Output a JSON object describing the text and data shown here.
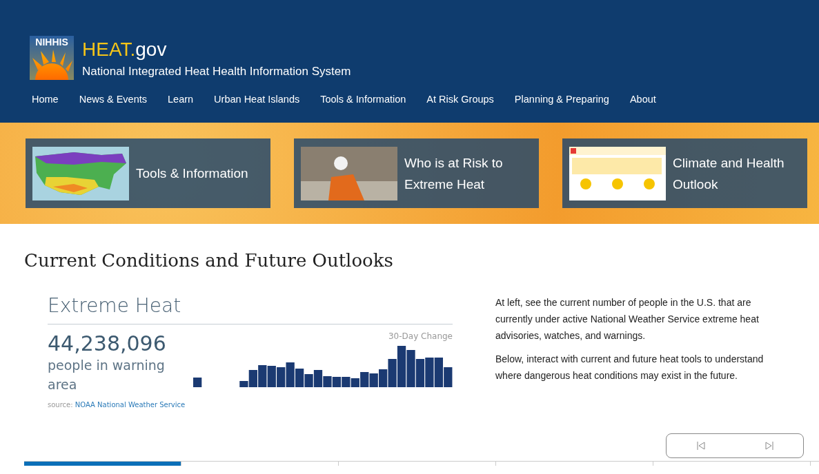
{
  "header": {
    "logo_text": "NIHHIS",
    "site_name_accent": "HEAT.",
    "site_name": "gov",
    "tagline": "National Integrated Heat Health Information System"
  },
  "nav": [
    {
      "label": "Home"
    },
    {
      "label": "News & Events"
    },
    {
      "label": "Learn"
    },
    {
      "label": "Urban Heat Islands"
    },
    {
      "label": "Tools & Information"
    },
    {
      "label": "At Risk Groups"
    },
    {
      "label": "Planning & Preparing"
    },
    {
      "label": "About"
    }
  ],
  "feature_cards": [
    {
      "kind": "map",
      "title": "Tools & Information"
    },
    {
      "kind": "photo",
      "title": "Who is at Risk to Extreme Heat"
    },
    {
      "kind": "poster",
      "title": "Climate and Health Outlook"
    }
  ],
  "section_title": "Current Conditions and Future Outlooks",
  "widget": {
    "title": "Extreme Heat",
    "count": "44,238,096",
    "count_label": "people in warning area",
    "chart_label": "30-Day Change",
    "source_label": "source:",
    "source_link": "NOAA National Weather Service"
  },
  "description": [
    "At left, see the current number of people in the U.S. that are currently under active National Weather Service extreme heat advisories, watches, and warnings.",
    "Below, interact with current and future heat tools to understand where dangerous heat conditions may exist in the future."
  ],
  "tabs": [
    {
      "selected": true
    },
    {
      "selected": false
    },
    {
      "selected": false
    },
    {
      "selected": false
    },
    {
      "selected": false
    }
  ]
}
